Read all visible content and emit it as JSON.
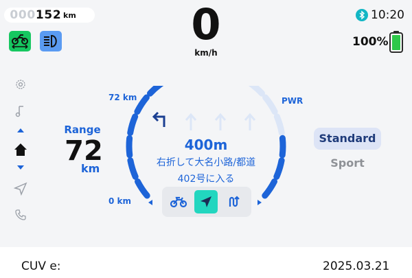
{
  "odometer": {
    "digits": [
      "0",
      "0",
      "0",
      "1",
      "5",
      "2"
    ],
    "unit": "km"
  },
  "indicators": {
    "traction_icon": "motorcycle-arrows-icon",
    "headlight_icon": "high-beam-icon",
    "traction_color": "#16c760",
    "headlight_color": "#5a9bf2"
  },
  "speed": {
    "value": "0",
    "unit": "km/h"
  },
  "status": {
    "bluetooth_icon": "bluetooth-icon",
    "time": "10:20",
    "battery_percent": "100%",
    "battery_level": 1.0,
    "battery_color": "#2ec84a"
  },
  "side_nav": {
    "items": [
      "settings-icon",
      "music-icon",
      "home-icon",
      "navigation-icon",
      "phone-icon"
    ],
    "active": "home-icon"
  },
  "range": {
    "label": "Range",
    "value": "72",
    "unit": "km"
  },
  "gauge": {
    "max_label": "72 km",
    "min_label": "0 km",
    "power_label": "PWR",
    "range_fraction": 1.0,
    "power_fraction": 0.45,
    "accent": "#1d64d8"
  },
  "navigation": {
    "distance": "400m",
    "instruction_line1": "右折して大名小路/都道",
    "instruction_line2": "402号に入る",
    "turn_icon": "turn-left-arrow-icon"
  },
  "modes_tray": {
    "items": [
      "motorcycle-icon",
      "navigation-arrow-icon",
      "route-icon"
    ],
    "active": "navigation-arrow-icon",
    "active_color": "#22d6bf"
  },
  "ride_modes": {
    "selected": "Standard",
    "other": "Sport"
  },
  "footer": {
    "left": "CUV e:",
    "right": "2025.03.21"
  }
}
